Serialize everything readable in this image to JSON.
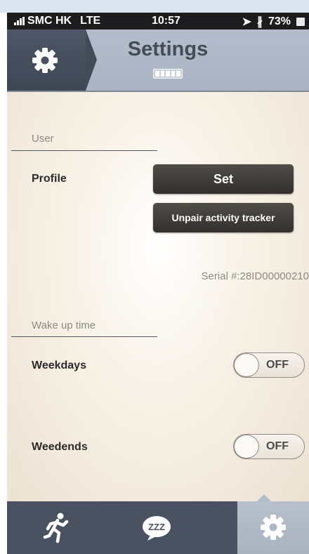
{
  "status_bar": {
    "carrier": "SMC HK",
    "network": "LTE",
    "time": "10:57",
    "battery": "73%",
    "icons": [
      "signal-icon",
      "location-icon",
      "bluetooth-icon",
      "battery-icon"
    ]
  },
  "header": {
    "title": "Settings",
    "icon": "gear-icon"
  },
  "user_section": {
    "label": "User",
    "profile_label": "Profile",
    "set_button": "Set",
    "unpair_button": "Unpair activity tracker",
    "serial": "Serial #:28ID00000210"
  },
  "wake_section": {
    "label": "Wake up time",
    "weekdays": {
      "label": "Weekdays",
      "toggle": "OFF"
    },
    "weekends": {
      "label": "Weedends",
      "toggle": "OFF"
    }
  },
  "tab_bar": {
    "tabs": [
      {
        "icon": "running-person-icon",
        "selected": false
      },
      {
        "icon": "sleep-zzz-icon",
        "text": "ZZZ",
        "selected": false
      },
      {
        "icon": "gear-icon",
        "selected": true
      }
    ]
  },
  "colors": {
    "header_bg": "#b4bdcb",
    "header_dark": "#434b59",
    "content_bg": "#f4eee3",
    "button_bg": "#3a3632",
    "tab_bar_bg": "#4a5261",
    "tab_selected_bg": "#b3bcc9"
  }
}
